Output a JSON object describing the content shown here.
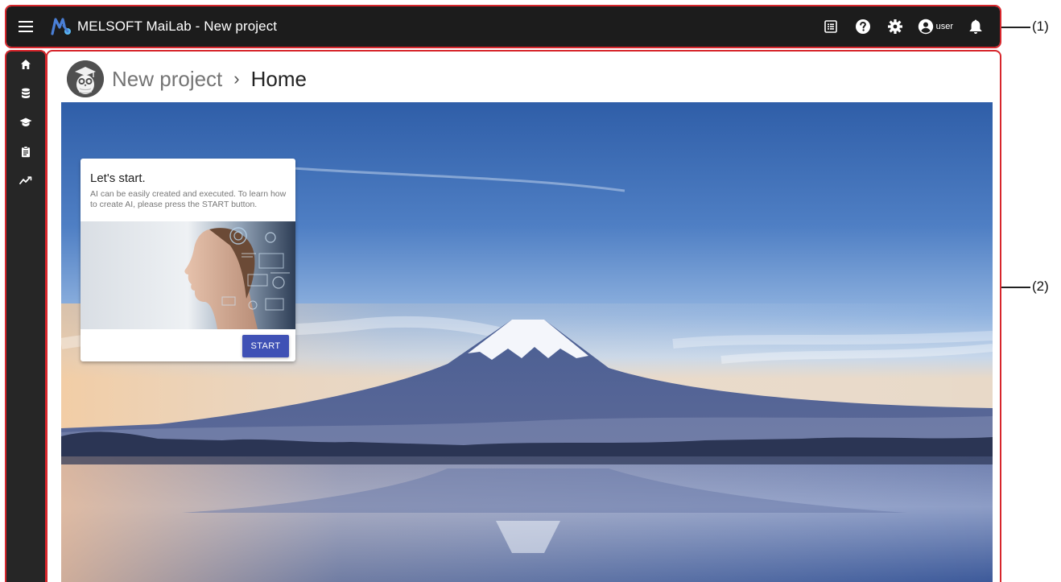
{
  "appbar": {
    "title": "MELSOFT MaiLab - New project",
    "user_name": "user",
    "icons": [
      "menu-icon",
      "app-logo",
      "list-icon",
      "help-icon",
      "gear-icon",
      "account-icon",
      "bell-icon"
    ]
  },
  "sidenav": {
    "items": [
      {
        "name": "home",
        "icon": "home-icon"
      },
      {
        "name": "data",
        "icon": "database-icon"
      },
      {
        "name": "learning",
        "icon": "graduation-cap-icon"
      },
      {
        "name": "reports",
        "icon": "clipboard-icon"
      },
      {
        "name": "analytics",
        "icon": "trend-line-icon"
      }
    ]
  },
  "breadcrumb": {
    "project": "New project",
    "separator": "›",
    "current": "Home"
  },
  "card": {
    "title": "Let's start.",
    "description": "AI can be easily created and executed. To learn how to create AI, please press the START button.",
    "button_label": "START"
  },
  "callouts": {
    "label_1": "(1)",
    "label_2": "(2)"
  },
  "colors": {
    "appbar": "#1c1c1c",
    "sidenav": "#262626",
    "primary_button": "#3f51b5",
    "callout_frame": "#d7262c"
  }
}
